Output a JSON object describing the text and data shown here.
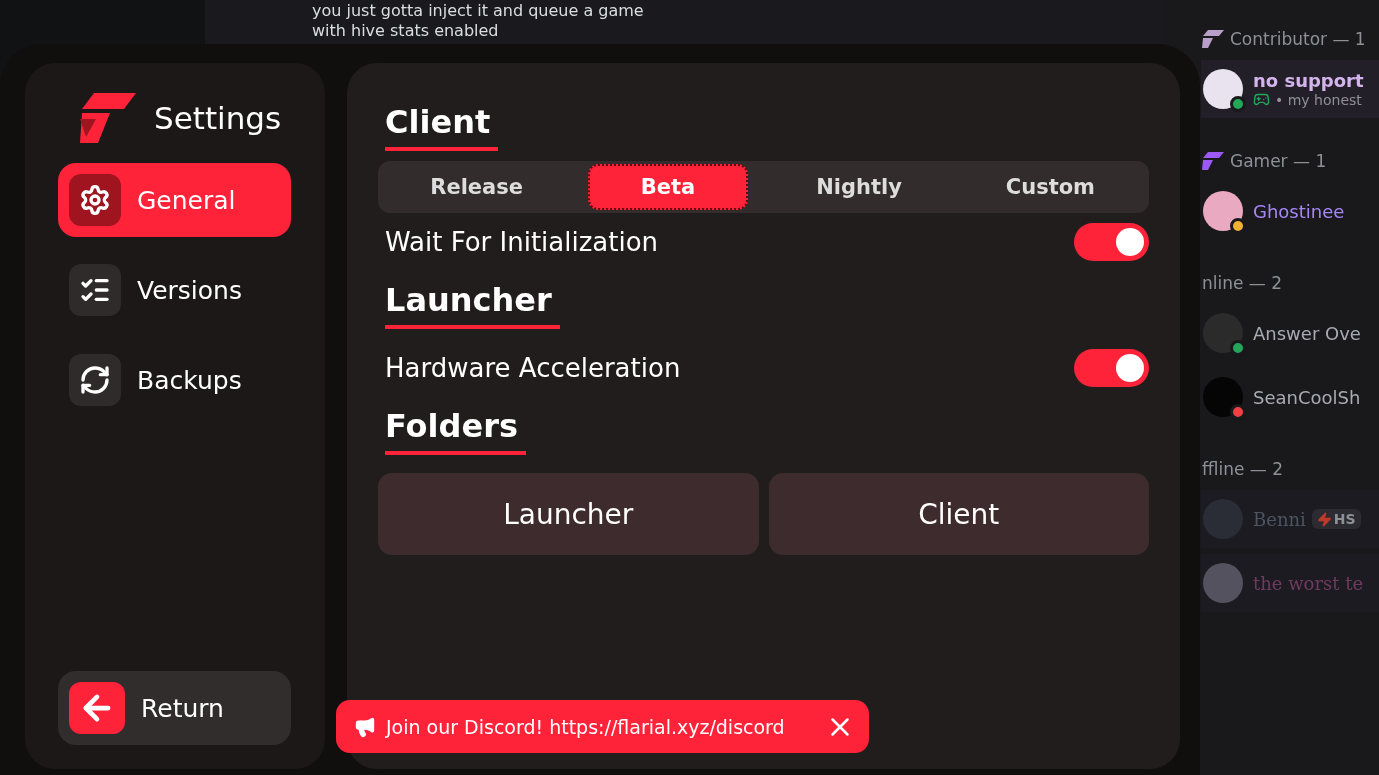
{
  "chat": {
    "messages": [
      "you just gotta inject it and queue a game",
      "with hive stats enabled"
    ]
  },
  "member_list": {
    "groups": [
      {
        "title": "Contributor — 1",
        "kind": "role",
        "color": "#b89fc9",
        "members": [
          {
            "name": {
              "text": "no support",
              "color": "#d4b4ec"
            },
            "status_dot": {
              "color": "#23a55a"
            },
            "activity": "• my honest",
            "selected": true,
            "offline": false
          }
        ]
      },
      {
        "title": "Gamer — 1",
        "kind": "role",
        "color": "#9b59f5",
        "members": [
          {
            "name": {
              "text": "Ghostinee",
              "color": "#a586f7"
            },
            "status_dot": {
              "color": "#f0b232"
            },
            "selected": false,
            "offline": false
          }
        ]
      },
      {
        "title": "nline — 2",
        "kind": "status",
        "members": [
          {
            "name": {
              "text": "Answer Ove",
              "color": "#a9aab3"
            },
            "status_dot": {
              "color": "#23a55a"
            },
            "selected": false,
            "offline": false
          },
          {
            "name": {
              "text": "SeanCoolSh",
              "color": "#a9aab3"
            },
            "status_dot": {
              "color": "#f23f43"
            },
            "selected": false,
            "offline": false
          }
        ]
      },
      {
        "title": "ffline — 2",
        "kind": "status",
        "members": [
          {
            "name": {
              "text": "Benni",
              "color": "#4a5560"
            },
            "badge": "HS",
            "selected": false,
            "offline": true
          },
          {
            "name": {
              "text": "the worst te",
              "color": "#6e3a5e"
            },
            "selected": false,
            "offline": true
          }
        ]
      }
    ]
  },
  "launcher": {
    "sidebar": {
      "title": "Settings",
      "items": [
        {
          "label": "General",
          "selected": true
        },
        {
          "label": "Versions",
          "selected": false
        },
        {
          "label": "Backups",
          "selected": false
        }
      ],
      "return_button": "Return"
    },
    "sections": [
      {
        "heading": "Client",
        "items": [
          {
            "kind": "tabs",
            "tabs": [
              {
                "label": "Release",
                "selected": false
              },
              {
                "label": "Beta",
                "selected": true
              },
              {
                "label": "Nightly",
                "selected": false
              },
              {
                "label": "Custom",
                "selected": false
              }
            ]
          },
          {
            "kind": "toggle",
            "label": "Wait For Initialization",
            "on": true
          }
        ]
      },
      {
        "heading": "Launcher",
        "items": [
          {
            "kind": "toggle",
            "label": "Hardware Acceleration",
            "on": true
          }
        ]
      },
      {
        "heading": "Folders",
        "items": [
          {
            "kind": "buttons",
            "buttons": [
              "Launcher",
              "Client"
            ]
          }
        ]
      }
    ],
    "banner": {
      "text": "Join our Discord! https://flarial.xyz/discord"
    }
  }
}
